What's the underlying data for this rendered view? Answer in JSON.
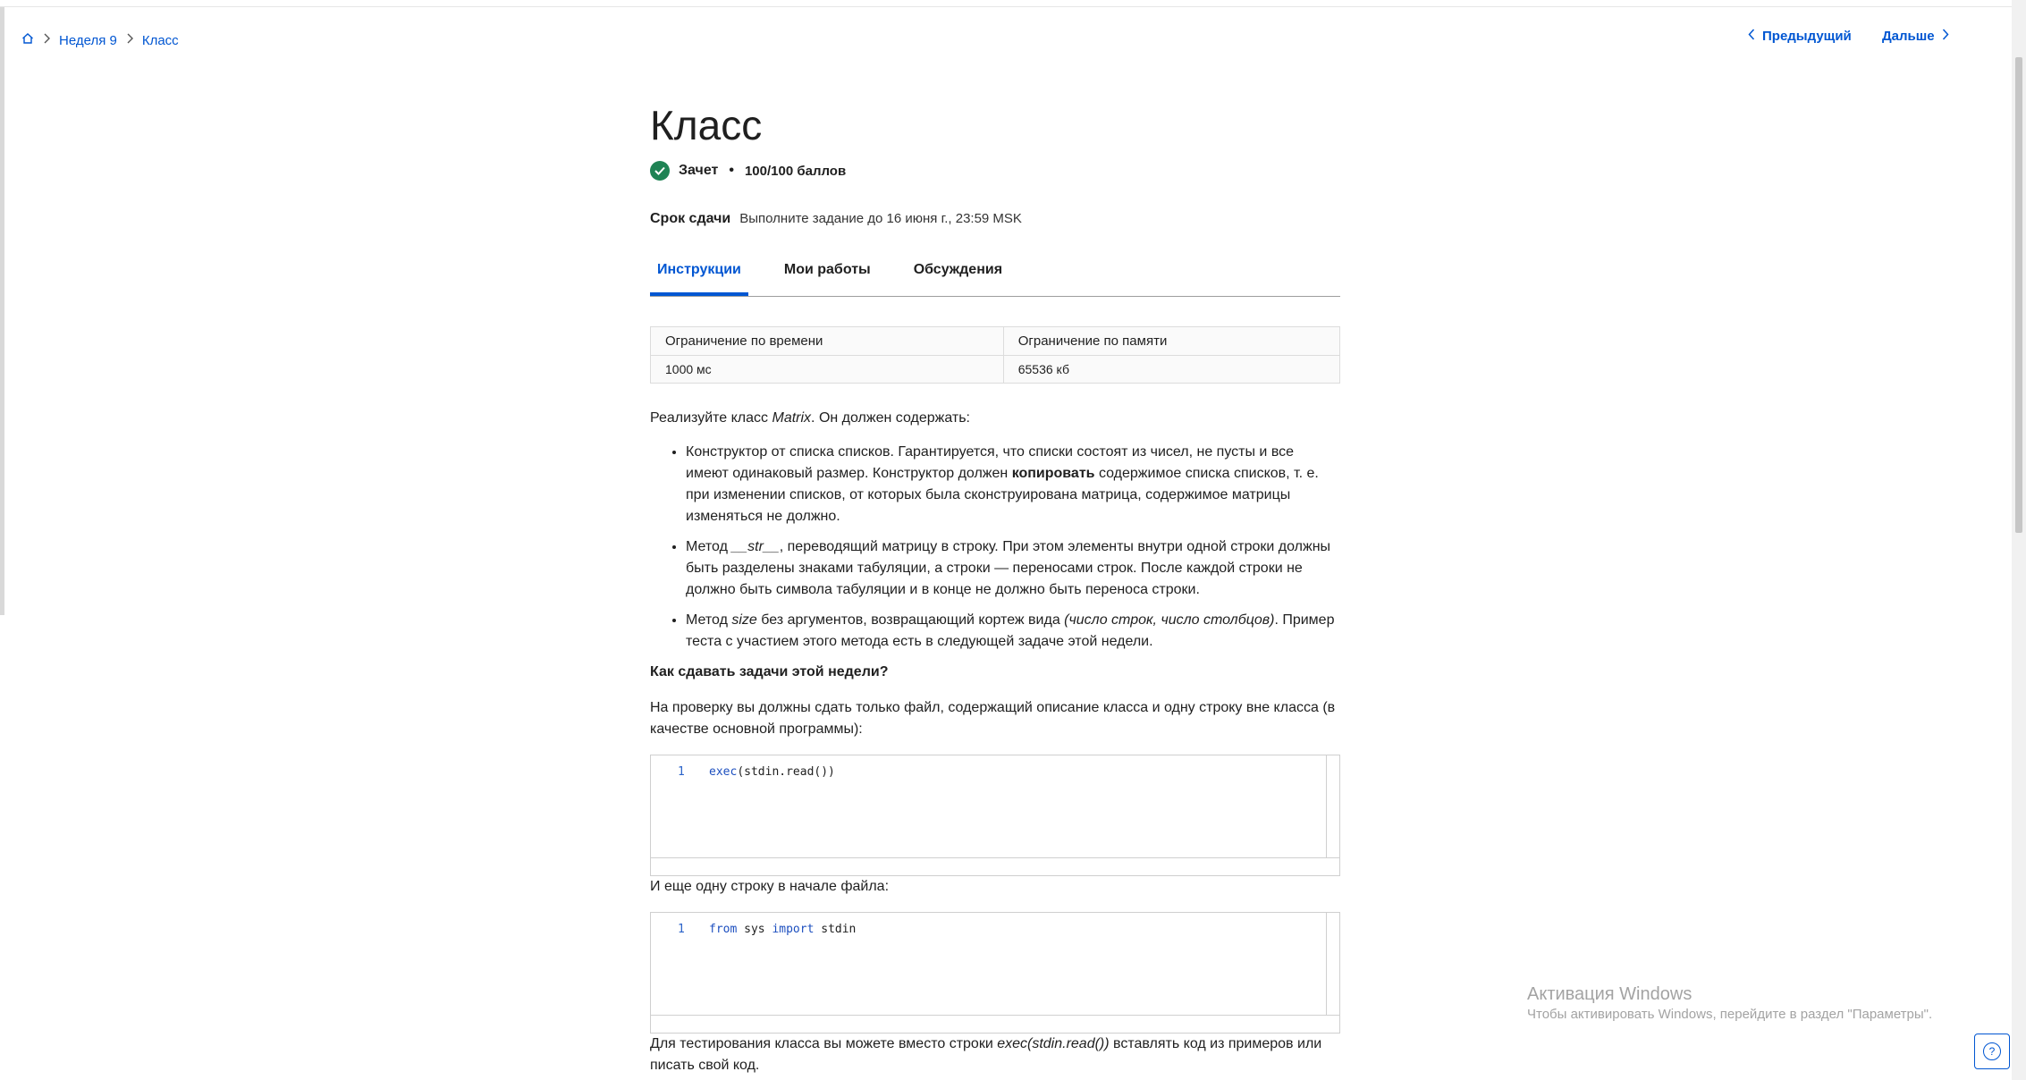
{
  "breadcrumb": {
    "week": "Неделя 9",
    "current": "Класс"
  },
  "nav": {
    "prev_label": "Предыдущий",
    "next_label": "Дальше"
  },
  "page": {
    "title": "Класс",
    "status": {
      "pass_label": "Зачет",
      "separator": "•",
      "score": "100/100 баллов"
    },
    "deadline": {
      "label": "Срок сдачи",
      "value": "Выполните задание до 16 июня г., 23:59 MSK"
    }
  },
  "tabs": [
    {
      "label": "Инструкции",
      "active": true
    },
    {
      "label": "Мои работы",
      "active": false
    },
    {
      "label": "Обсуждения",
      "active": false
    }
  ],
  "limits": {
    "headers": [
      "Ограничение по времени",
      "Ограничение по памяти"
    ],
    "values": [
      "1000 мс",
      "65536 кб"
    ]
  },
  "content": {
    "intro_a": "Реализуйте класс ",
    "intro_class": "Matrix",
    "intro_b": ". Он должен содержать:",
    "bullet1_a": " Конструктор от списка списков. Гарантируется, что списки состоят из чисел, не пусты и все имеют одинаковый размер. Конструктор должен ",
    "bullet1_bold": "копировать",
    "bullet1_b": " содержимое списка списков, т. е. при изменении списков, от которых была сконструирована матрица, содержимое матрицы изменяться не должно.",
    "bullet2_a": " Метод ",
    "bullet2_method": "__str__",
    "bullet2_b": ", переводящий матрицу в строку. При этом элементы внутри одной строки должны быть разделены знаками табуляции, а строки  —  переносами строк. После каждой строки не должно быть символа табуляции и в конце не должно быть переноса строки.",
    "bullet3_a": " Метод ",
    "bullet3_method": "size",
    "bullet3_b": " без аргументов, возвращающий кортеж вида ",
    "bullet3_tuple": "(число строк, число столбцов)",
    "bullet3_c": ". Пример теста с участием этого метода есть в следующей задаче этой недели.",
    "heading": "Как сдавать задачи этой недели?",
    "p_submit": "На проверку вы должны сдать только файл, содержащий описание класса и одну строку вне класса (в качестве основной программы):",
    "code1": {
      "line": "1",
      "fn": "exec",
      "rest": "(stdin.read())"
    },
    "p_also": "И еще одну строку в начале файла:",
    "code2": {
      "line": "1",
      "kw1": "from",
      "mid": " sys ",
      "kw2": "import",
      "end": " stdin"
    },
    "p_test_a": "Для тестирования класса вы можете вместо строки ",
    "p_test_code": "exec(stdin.read())",
    "p_test_b": " вставлять код из примеров или писать свой код."
  },
  "activation": {
    "title": "Активация Windows",
    "subtitle": "Чтобы активировать Windows, перейдите в раздел \"Параметры\"."
  },
  "help_label": "?",
  "colors": {
    "accent": "#0056d2",
    "success": "#1f8354",
    "text": "#1f1f1f"
  }
}
